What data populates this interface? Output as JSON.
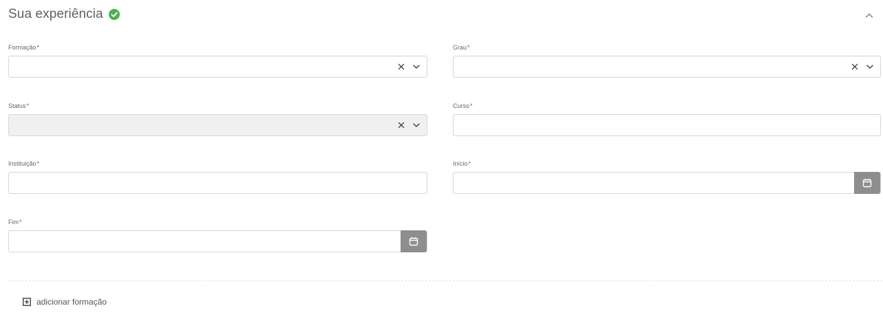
{
  "section": {
    "title": "Sua experiência"
  },
  "fields": {
    "formacao": {
      "label": "Formação",
      "required_mark": "*",
      "value": ""
    },
    "grau": {
      "label": "Grau",
      "required_mark": "*",
      "value": ""
    },
    "status": {
      "label": "Status",
      "required_mark": "*",
      "value": ""
    },
    "curso": {
      "label": "Curso",
      "required_mark": "*",
      "value": ""
    },
    "instituicao": {
      "label": "Instituição",
      "required_mark": "*",
      "value": ""
    },
    "inicio": {
      "label": "Início",
      "required_mark": "*",
      "value": ""
    },
    "fim": {
      "label": "Fim",
      "required_mark": "*",
      "value": ""
    }
  },
  "actions": {
    "add_label": "adicionar formação"
  },
  "icons": {
    "success": "check-circle-icon",
    "collapse": "chevron-up-icon",
    "clear": "close-icon",
    "dropdown": "chevron-down-icon",
    "calendar": "calendar-icon",
    "add": "plus-square-icon"
  },
  "colors": {
    "success": "#4caf50",
    "calendar_button": "#8e8e8e",
    "disabled_bg": "#f0f0f0",
    "border": "#d5d5d5"
  }
}
